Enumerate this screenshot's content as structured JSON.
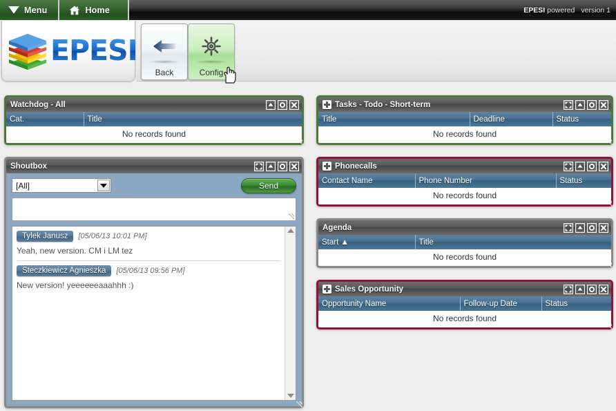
{
  "topbar": {
    "tabs": [
      {
        "label": "Menu",
        "icon": "triangle-down-icon"
      },
      {
        "label": "Home",
        "icon": "home-icon"
      }
    ],
    "brand": "EPESI powered",
    "version": "version 1"
  },
  "header": {
    "logo_text": "EPESI",
    "logo_icon": "epesi-stack-logo"
  },
  "toolbar": {
    "buttons": [
      {
        "label": "Back",
        "icon": "back-arrow-icon"
      },
      {
        "label": "Config",
        "icon": "gear-icon"
      }
    ]
  },
  "panels": {
    "watchdog": {
      "title": "Watchdog - All",
      "border_color": "#4a7a3a",
      "has_plus": false,
      "controls": [
        "collapse-icon",
        "settings-icon",
        "close-icon"
      ],
      "columns": [
        "Cat.",
        "Title"
      ],
      "empty_text": "No records found"
    },
    "tasks": {
      "title": "Tasks - Todo - Short-term",
      "border_color": "#4a7a3a",
      "has_plus": true,
      "controls": [
        "maximize-icon",
        "collapse-icon",
        "settings-icon",
        "close-icon"
      ],
      "columns": [
        "Title",
        "Deadline",
        "Status"
      ],
      "empty_text": "No records found"
    },
    "shoutbox": {
      "title": "Shoutbox",
      "border_color": "#888888",
      "has_plus": false,
      "controls": [
        "maximize-icon",
        "collapse-icon",
        "settings-icon",
        "close-icon"
      ],
      "recipient_selected": "[All]",
      "recipient_options": [
        "[All]"
      ],
      "message_placeholder": "",
      "message_value": "",
      "send_label": "Send",
      "messages": [
        {
          "author": "Tylek Janusz",
          "timestamp": "[05/06/13 10:01 PM]",
          "text": "Yeah, new version. CM i LM tez"
        },
        {
          "author": "Steczkiewicz Agnieszka",
          "timestamp": "[05/06/13 09:56 PM]",
          "text": "New version! yeeeeeeaaahhh :)"
        }
      ]
    },
    "phonecalls": {
      "title": "Phonecalls",
      "border_color": "#8d1537",
      "has_plus": true,
      "controls": [
        "maximize-icon",
        "collapse-icon",
        "settings-icon",
        "close-icon"
      ],
      "columns": [
        "Contact Name",
        "Phone Number",
        "Status"
      ],
      "empty_text": "No records found"
    },
    "agenda": {
      "title": "Agenda",
      "border_color": "#888888",
      "has_plus": false,
      "controls": [
        "maximize-icon",
        "collapse-icon",
        "settings-icon",
        "close-icon"
      ],
      "columns": [
        "Start ▲",
        "Title"
      ],
      "empty_text": "No records found"
    },
    "sales_opportunity": {
      "title": "Sales Opportunity",
      "border_color": "#8d1537",
      "has_plus": true,
      "controls": [
        "maximize-icon",
        "collapse-icon",
        "settings-icon",
        "close-icon"
      ],
      "columns": [
        "Opportunity Name",
        "Follow-up Date",
        "Status"
      ],
      "empty_text": "No records found"
    }
  }
}
